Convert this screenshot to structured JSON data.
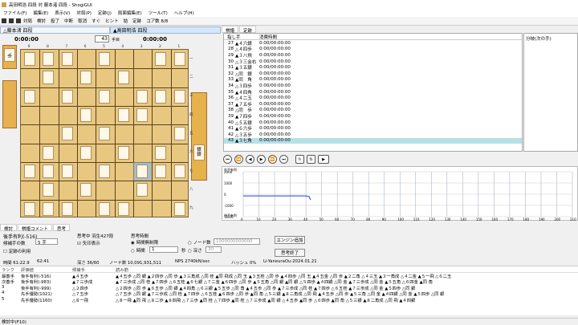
{
  "window": {
    "title": "高田明浩 四段 対 藤本渚 四段 - ShogiGUI"
  },
  "menu": [
    "ファイル(F)",
    "編集(E)",
    "表示(V)",
    "対局(P)",
    "定跡(J)",
    "局面編集(E)",
    "ツール(T)",
    "ヘルプ(H)"
  ],
  "toolbar": {
    "items": [
      "対局",
      "検討",
      "投了",
      "中断",
      "取消",
      "すぐ",
      "ヒント",
      "詰",
      "定跡",
      "コア数 8/8"
    ]
  },
  "board": {
    "gote_name": "△藤本渚 四段",
    "sente_name": "▲高田明浩 四段",
    "gote_time": "0:00:00",
    "sente_time": "0:00:00",
    "move_number": "43",
    "move_suffix": "手目",
    "files": [
      "9",
      "8",
      "7",
      "6",
      "5",
      "4",
      "3",
      "2",
      "1"
    ],
    "ranks": [
      "一",
      "二",
      "三",
      "四",
      "五",
      "六",
      "七",
      "八",
      "九"
    ],
    "gote_hand": [
      "歩"
    ],
    "sente_hand": [
      "銀",
      "銀",
      "歩"
    ]
  },
  "kifu_tabs": [
    "棋譜",
    "定跡"
  ],
  "kifu_header": {
    "move": "指し手",
    "time": "消費時間"
  },
  "kifu": [
    {
      "n": "27",
      "move": "▲４六銀",
      "time": "0:00/00:00:00"
    },
    {
      "n": "28",
      "move": "△４四歩",
      "time": "0:00/00:00:00"
    },
    {
      "n": "29",
      "move": "▲３八飛",
      "time": "0:00/00:00:00"
    },
    {
      "n": "30",
      "move": "△３三金右",
      "time": "0:00/00:00:00"
    },
    {
      "n": "31",
      "move": "▲３五銀",
      "time": "0:00/00:00:00"
    },
    {
      "n": "32",
      "move": "△同　銀",
      "time": "0:00/00:00:00"
    },
    {
      "n": "33",
      "move": "▲同　角",
      "time": "0:00/00:00:00"
    },
    {
      "n": "34",
      "move": "△３四歩",
      "time": "0:00/00:00:00"
    },
    {
      "n": "35",
      "move": "▲４四角",
      "time": "0:00/00:00:00"
    },
    {
      "n": "36",
      "move": "△４二玉",
      "time": "0:00/00:00:00"
    },
    {
      "n": "37",
      "move": "▲７五歩",
      "time": "0:00/00:00:00"
    },
    {
      "n": "38",
      "move": "△同　歩",
      "time": "0:00/00:00:00"
    },
    {
      "n": "39",
      "move": "▲７四歩",
      "time": "0:00/00:00:00"
    },
    {
      "n": "40",
      "move": "△５五銀",
      "time": "0:00/00:00:00"
    },
    {
      "n": "41",
      "move": "▲６六歩",
      "time": "0:00/00:00:00"
    },
    {
      "n": "42",
      "move": "△３五歩",
      "time": "0:00/00:00:00"
    },
    {
      "n": "43",
      "move": "▲３七角",
      "time": "0:00/00:00:00"
    }
  ],
  "branch_title": "分岐(次の手)",
  "graph": {
    "ylabel": "先手有利",
    "ylabel2": "後手有利",
    "ticks_y": [
      "2000",
      "1000",
      "0",
      "-1000",
      "-2000"
    ],
    "ticks_x": [
      "0",
      "10",
      "20",
      "30",
      "40",
      "50",
      "60",
      "70",
      "80",
      "90",
      "100",
      "110",
      "120",
      "130",
      "140",
      "150",
      "160",
      "170",
      "180",
      "190",
      "200",
      "210"
    ]
  },
  "console": {
    "tabs": [
      "検討",
      "棋譜コメント",
      "思考"
    ],
    "eval_label": "後手有利(-516)",
    "candidates_label": "候補手の数",
    "candidates_value": "5 手",
    "joseki_label": "定跡の利用",
    "thinking_label": "思考中 羽生427段",
    "arrows_label": "矢印表示",
    "time_label": "思考時間",
    "unlimited_label": "時間無制限",
    "seconds_label": "時間",
    "seconds_value": "1",
    "seconds_unit": "秒",
    "depth_label": "深さ",
    "depth_value": "30",
    "nodes_label": "ノード数",
    "nodes_value": "1000000000000",
    "add_engine": "エンジン追加",
    "stop_button": "思考終了",
    "stats": {
      "time": "時間 61:22.9",
      "t2": "62:41",
      "depth": "深さ 36/60",
      "nodes": "ノード数 10,091,931,511",
      "nps": "NPS 2740kN/sec",
      "hash": "ハッシュ 0%",
      "engine": "Li-YaneuraOu-2024.01.21"
    },
    "pv_header": {
      "rank": "ランク",
      "eval": "評価値",
      "cand": "候補手",
      "pv": "読み筋"
    },
    "pv": [
      {
        "rank": "最善手",
        "eval": "後手有利(-516)",
        "cand": "▲４五歩",
        "line": "▲４五歩 △同 銀 ▲２四歩 △同 歩 ▲３三角成 △同 桂 ▲同 飛成 △同 玉 ▲３五桂 △同 歩 ▲４四歩 △同 玉 ▲４五金 △同 歩 ▲２二角 △４三玉 ▲３一角成 △４二金 ▲５一飛 △６二玉"
      },
      {
        "rank": "次善手",
        "eval": "後手有利(-983)",
        "cand": "▲７三歩成",
        "line": "▲７三歩成 △同 桂 ▲７四歩 △６五桂 ▲６七銀 △７二金 ▲６四歩 △同 歩 ▲５五角 △同 銀 ▲同 銀 △５四歩 ▲４四銀 △同 金 ▲７三歩成 △同 金 ▲５五角 △６四金 ▲同 角"
      },
      {
        "rank": "3",
        "eval": "後手有利(-999)",
        "cand": "△２四歩",
        "line": "△２四歩 △同 歩 ▲６五歩 △同 銀 ▲４四角 △６三銀 ▲５五歩 △同 角 ▲４五歩 △同 歩 ▲７三歩成 △同 桂 ▲７四歩 △６五桂 ▲７三歩成 △同 金 ▲５四歩 △同 銀"
      },
      {
        "rank": "4",
        "eval": "先手優勢(1021)",
        "cand": "△７五歩",
        "line": "△７五歩 △同 銀 ▲７三歩成 △同 桂 ▲７四歩 △６五桂 ▲６四歩 △同 歩 ▲同 角 △５三銀 ▲８二角成 △同 飛 ▲４五歩 △同 歩 ▲５三角 △同 金 ▲４四銀 △同 金 ▲５四歩 △同 銀"
      },
      {
        "rank": "5",
        "eval": "先手優勢(1160)",
        "cand": "△８一飛",
        "line": "△８一飛 ▲同 飛 △８二歩 ▲８四飛 △７三歩 ▲同 桂 △７四歩 ▲同 桂 △７三歩成 ▲同 銀 △４五歩 ▲同 歩 △６四歩 ▲同 角 △５三銀 ▲８二角成 △同 飛 ▲４四銀"
      }
    ]
  },
  "status": "検討中(F10)"
}
